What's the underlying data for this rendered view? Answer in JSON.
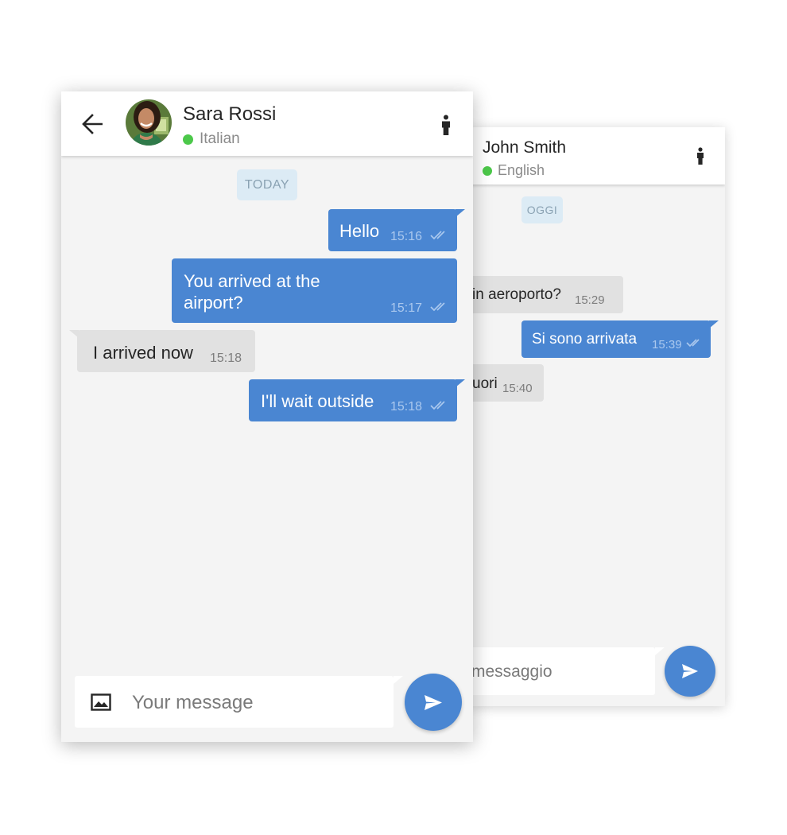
{
  "back_chat": {
    "contact_name": "John Smith",
    "language": "English",
    "date_chip": "OGGI",
    "messages": [
      {
        "direction": "in",
        "text": "in aeroporto?",
        "time": "15:29"
      },
      {
        "direction": "out",
        "text": "Si sono arrivata",
        "time": "15:39"
      },
      {
        "direction": "in",
        "text": "uori",
        "time": "15:40"
      }
    ],
    "input_placeholder": "messaggio"
  },
  "front_chat": {
    "contact_name": "Sara Rossi",
    "language": "Italian",
    "date_chip": "TODAY",
    "messages": [
      {
        "direction": "out",
        "text": "Hello",
        "time": "15:16"
      },
      {
        "direction": "out",
        "text": "You arrived at the",
        "text_line2": "airport?",
        "time": "15:17"
      },
      {
        "direction": "in",
        "text": "I arrived now",
        "time": "15:18"
      },
      {
        "direction": "out",
        "text": "I'll wait outside",
        "time": "15:18"
      }
    ],
    "input_placeholder": "Your message"
  },
  "colors": {
    "accent_blue": "#4a86d2",
    "incoming_bubble": "#e1e1e1",
    "online_green": "#4cc84a",
    "chat_background": "#f4f4f4"
  },
  "icons": [
    "back-arrow-icon",
    "person-icon",
    "image-icon",
    "send-icon",
    "double-check-icon",
    "online-dot-icon"
  ]
}
